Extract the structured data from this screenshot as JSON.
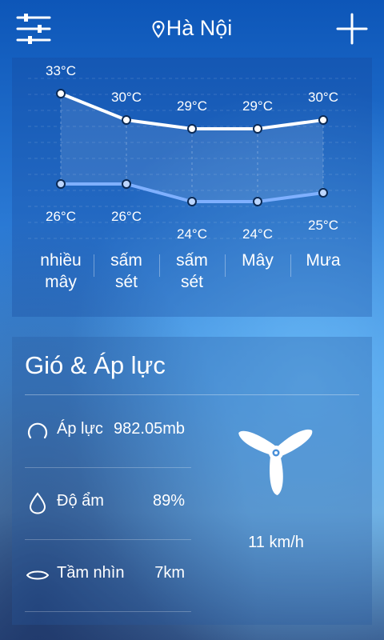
{
  "header": {
    "menu_icon": "sliders-icon",
    "location_icon": "map-pin-icon",
    "location": "Hà Nội",
    "add_icon": "plus-icon"
  },
  "forecast": {
    "days": [
      {
        "high": 33,
        "high_label": "33°C",
        "low": 26,
        "low_label": "26°C",
        "condition": [
          "nhiều",
          "mây"
        ]
      },
      {
        "high": 30,
        "high_label": "30°C",
        "low": 26,
        "low_label": "26°C",
        "condition": [
          "sấm",
          "sét"
        ]
      },
      {
        "high": 29,
        "high_label": "29°C",
        "low": 24,
        "low_label": "24°C",
        "condition": [
          "sấm",
          "sét"
        ]
      },
      {
        "high": 29,
        "high_label": "29°C",
        "low": 24,
        "low_label": "24°C",
        "condition": [
          "Mây"
        ]
      },
      {
        "high": 30,
        "high_label": "30°C",
        "low": 25,
        "low_label": "25°C",
        "condition": [
          "Mưa"
        ]
      }
    ],
    "colors": {
      "high_line": "#ffffff",
      "low_line": "#7fb0ff"
    }
  },
  "wind_pressure": {
    "title": "Gió & Áp lực",
    "rows": [
      {
        "icon": "pressure-gauge-icon",
        "label": "Áp lực",
        "value": "982.05mb"
      },
      {
        "icon": "water-drop-icon",
        "label": "Độ ẩm",
        "value": "89%"
      },
      {
        "icon": "eye-icon",
        "label": "Tầm nhìn",
        "value": "7km"
      }
    ],
    "wind_icon": "wind-turbine-icon",
    "wind_speed": "11 km/h"
  }
}
